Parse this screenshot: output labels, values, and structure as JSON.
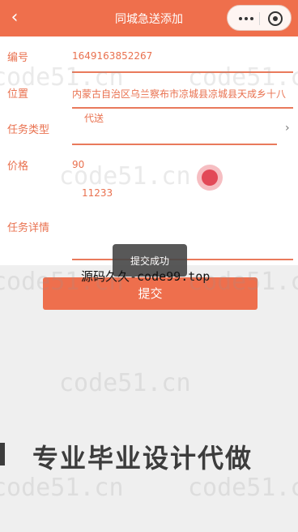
{
  "navbar": {
    "title": "同城急送添加",
    "back_icon": "chevron-left-icon"
  },
  "form": {
    "number": {
      "label": "编号",
      "value": "1649163852267"
    },
    "location": {
      "label": "位置",
      "value": "内蒙古自治区乌兰察布市凉城县凉城县天成乡十八"
    },
    "task_type": {
      "label": "任务类型",
      "value": "代送"
    },
    "price": {
      "label": "价格",
      "value": "90"
    },
    "details": {
      "label": "任务详情",
      "value": "11233"
    }
  },
  "toast": {
    "text": "提交成功"
  },
  "submit": {
    "label": "提交"
  },
  "watermarks": {
    "site": "code51.cn",
    "line": "源码久久-code99.top",
    "banner": "专业毕业设计代做"
  },
  "colors": {
    "accent": "#ef6f4c",
    "text_accent": "#e9714f"
  }
}
